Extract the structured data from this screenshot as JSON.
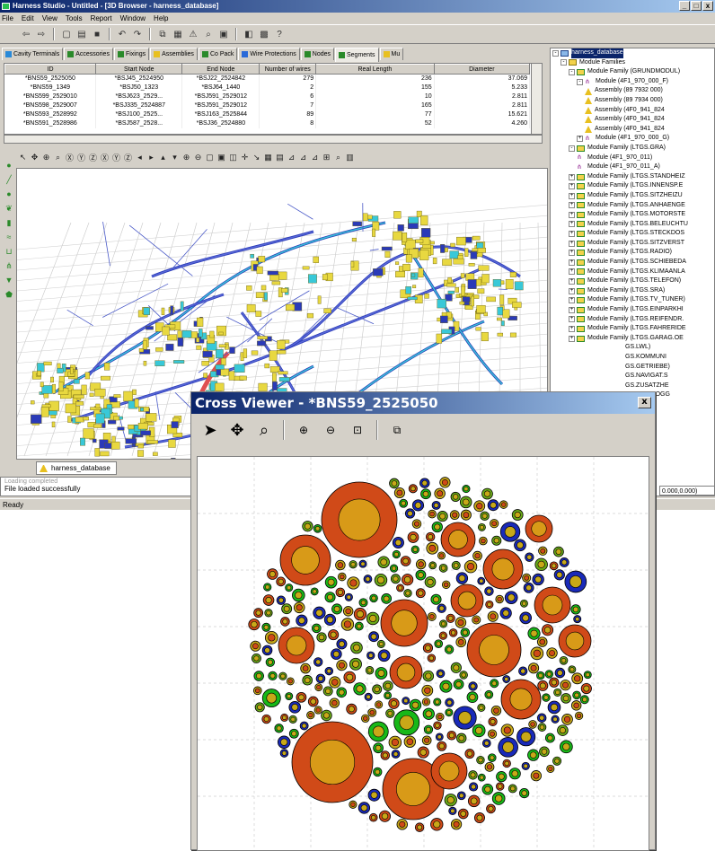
{
  "window": {
    "title": "Harness Studio - Untitled - [3D Browser - harness_database]",
    "controls": [
      "_",
      "□",
      "x"
    ]
  },
  "menu": [
    "File",
    "Edit",
    "View",
    "Tools",
    "Report",
    "Window",
    "Help"
  ],
  "tabs": [
    {
      "label": "Cavity Terminals",
      "icon_color": "#2a8ad8"
    },
    {
      "label": "Accessories",
      "icon_color": "#2a8a2a"
    },
    {
      "label": "Fixings",
      "icon_color": "#2a8a2a"
    },
    {
      "label": "Assemblies",
      "icon_color": "#e8c020"
    },
    {
      "label": "Co Pack",
      "icon_color": "#2a8a2a"
    },
    {
      "label": "Wire Protections",
      "icon_color": "#2a6ad8"
    },
    {
      "label": "Nodes",
      "icon_color": "#2a8a2a"
    },
    {
      "label": "Segments",
      "icon_color": "#2a8a2a",
      "active": true
    },
    {
      "label": "Mu",
      "icon_color": "#e8c020"
    }
  ],
  "grid": {
    "columns": [
      "ID",
      "Start Node",
      "End Node",
      "Number of wires",
      "Real Length",
      "Diameter"
    ],
    "rows": [
      [
        "*BNS59_2525050",
        "*BSJ45_2524950",
        "*BSJ22_2524842",
        "279",
        "236",
        "37.069"
      ],
      [
        "*BNS59_1349",
        "*BSJ50_1323",
        "*BSJ64_1440",
        "2",
        "155",
        "5.233"
      ],
      [
        "*BNS599_2529010",
        "*BSJ623_2529...",
        "*BSJ591_2529012",
        "6",
        "10",
        "2.811"
      ],
      [
        "*BNS598_2529007",
        "*BSJ335_2524887",
        "*BSJ591_2529012",
        "7",
        "165",
        "2.811"
      ],
      [
        "*BNS593_2528992",
        "*BSJ100_2525...",
        "*BSJ163_2525844",
        "89",
        "77",
        "15.621"
      ],
      [
        "*BNS591_2528986",
        "*BSJ587_2528...",
        "*BSJ36_2524880",
        "8",
        "52",
        "4.260"
      ]
    ]
  },
  "tree": {
    "root": "harness_database",
    "items": [
      {
        "label": "harness_database",
        "icon": "db",
        "depth": 0,
        "exp": "-",
        "selected": true
      },
      {
        "label": "Module Families",
        "icon": "folder",
        "depth": 1,
        "exp": "-"
      },
      {
        "label": "Module Family (GRUNDMODUL)",
        "icon": "mfam",
        "depth": 2,
        "exp": "-"
      },
      {
        "label": "Module (4F1_970_000_F)",
        "icon": "mod",
        "depth": 3,
        "exp": "-"
      },
      {
        "label": "Assembly (89 7932 000)",
        "icon": "warn",
        "depth": 4,
        "exp": ""
      },
      {
        "label": "Assembly (89 7934 000)",
        "icon": "warn",
        "depth": 4,
        "exp": ""
      },
      {
        "label": "Assembly (4F0_941_824",
        "icon": "warn",
        "depth": 4,
        "exp": ""
      },
      {
        "label": "Assembly (4F0_941_824",
        "icon": "warn",
        "depth": 4,
        "exp": ""
      },
      {
        "label": "Assembly (4F0_941_824",
        "icon": "warn",
        "depth": 4,
        "exp": ""
      },
      {
        "label": "Module (4F1_970_000_G)",
        "icon": "mod",
        "depth": 3,
        "exp": "+"
      },
      {
        "label": "Module Family (LTGS.GRA)",
        "icon": "mfam",
        "depth": 2,
        "exp": "-"
      },
      {
        "label": "Module (4F1_970_011)",
        "icon": "mod",
        "depth": 3,
        "exp": ""
      },
      {
        "label": "Module (4F1_970_011_A)",
        "icon": "mod",
        "depth": 3,
        "exp": ""
      },
      {
        "label": "Module Family (LTGS.STANDHEIZ",
        "icon": "mfam",
        "depth": 2,
        "exp": "+"
      },
      {
        "label": "Module Family (LTGS.INNENSP.E",
        "icon": "mfam",
        "depth": 2,
        "exp": "+"
      },
      {
        "label": "Module Family (LTGS.SITZHEIZU",
        "icon": "mfam",
        "depth": 2,
        "exp": "+"
      },
      {
        "label": "Module Family (LTGS.ANHAENGE",
        "icon": "mfam",
        "depth": 2,
        "exp": "+"
      },
      {
        "label": "Module Family (LTGS.MOTORSTE",
        "icon": "mfam",
        "depth": 2,
        "exp": "+"
      },
      {
        "label": "Module Family (LTGS.BELEUCHTU",
        "icon": "mfam",
        "depth": 2,
        "exp": "+"
      },
      {
        "label": "Module Family (LTGS.STECKDOS",
        "icon": "mfam",
        "depth": 2,
        "exp": "+"
      },
      {
        "label": "Module Family (LTGS.SITZVERST",
        "icon": "mfam",
        "depth": 2,
        "exp": "+"
      },
      {
        "label": "Module Family (LTGS.RADIO)",
        "icon": "mfam",
        "depth": 2,
        "exp": "+"
      },
      {
        "label": "Module Family (LTGS.SCHIEBEDA",
        "icon": "mfam",
        "depth": 2,
        "exp": "+"
      },
      {
        "label": "Module Family (LTGS.KLIMAANLA",
        "icon": "mfam",
        "depth": 2,
        "exp": "+"
      },
      {
        "label": "Module Family (LTGS.TELEFON)",
        "icon": "mfam",
        "depth": 2,
        "exp": "+"
      },
      {
        "label": "Module Family (LTGS.SRA)",
        "icon": "mfam",
        "depth": 2,
        "exp": "+"
      },
      {
        "label": "Module Family (LTGS.TV_TUNER)",
        "icon": "mfam",
        "depth": 2,
        "exp": "+"
      },
      {
        "label": "Module Family (LTGS.EINPARKHI",
        "icon": "mfam",
        "depth": 2,
        "exp": "+"
      },
      {
        "label": "Module Family (LTGS.REIFENDR.",
        "icon": "mfam",
        "depth": 2,
        "exp": "+"
      },
      {
        "label": "Module Family (LTGS.FAHRERIDE",
        "icon": "mfam",
        "depth": 2,
        "exp": "+"
      },
      {
        "label": "Module Family (LTGS.GARAG.OE",
        "icon": "mfam",
        "depth": 2,
        "exp": "+"
      },
      {
        "label": "GS.LWL)",
        "icon": "none",
        "depth": 9,
        "exp": ""
      },
      {
        "label": "GS.KOMMUNI",
        "icon": "none",
        "depth": 9,
        "exp": ""
      },
      {
        "label": "GS.GETRIEBE)",
        "icon": "none",
        "depth": 9,
        "exp": ""
      },
      {
        "label": "GS.NAVIGAT.S",
        "icon": "none",
        "depth": 9,
        "exp": ""
      },
      {
        "label": "GS.ZUSATZHE",
        "icon": "none",
        "depth": 9,
        "exp": ""
      },
      {
        "label": "GS.DATALOGG",
        "icon": "none",
        "depth": 9,
        "exp": ""
      }
    ]
  },
  "bottom_tab": "harness_database",
  "output": {
    "ghost": "Loading completed",
    "message": "File loaded successfully"
  },
  "status": "Ready",
  "coords": "0.000,0.000)",
  "cross_viewer": {
    "title": "Cross Viewer - *BNS59_2525050",
    "close": "x",
    "wire_colors": {
      "large": "#d04a18",
      "large_inner": "#d89a18",
      "blue": "#1a2ab8",
      "green": "#18b818",
      "teal": "#6aaa18",
      "olive": "#c8a818"
    }
  }
}
